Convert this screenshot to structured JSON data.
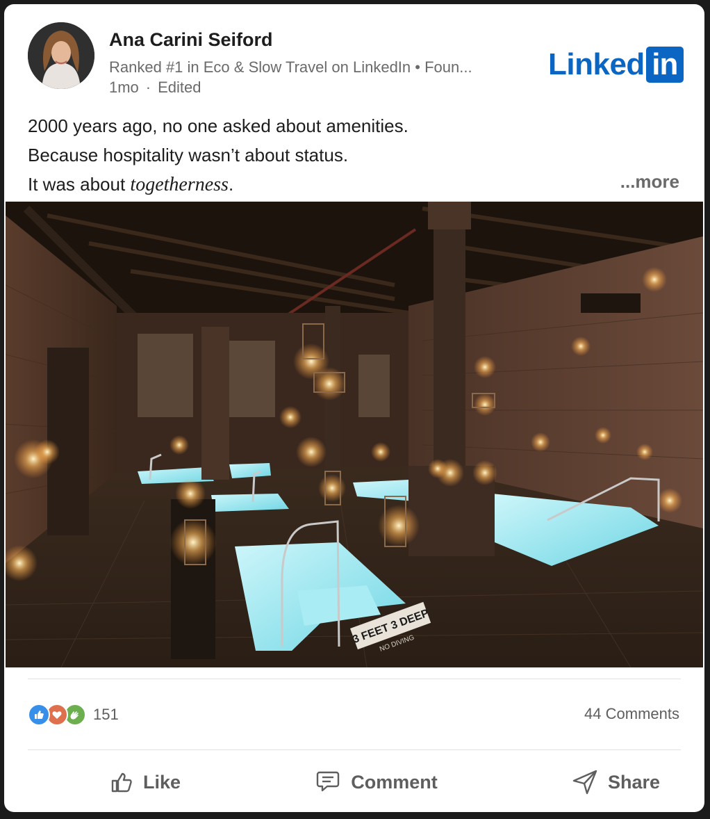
{
  "post": {
    "author": {
      "name": "Ana Carini Seiford",
      "headline": "Ranked #1 in Eco & Slow Travel on LinkedIn • Foun...",
      "time": "1mo",
      "separator": "·",
      "edited": "Edited"
    },
    "brand": {
      "word": "Linked",
      "box": "in"
    },
    "text": {
      "line1": "2000 years ago, no one asked about amenities.",
      "line2": "Because hospitality wasn’t about status.",
      "line3_prefix": "It was about ",
      "line3_italic": "togetherness",
      "line3_suffix": ".",
      "more": "...more"
    },
    "image": {
      "sign_text": "3 FEET 3 DEEP",
      "sign_sub": "NO DIVING"
    },
    "social": {
      "reactions": [
        "like-reaction-icon",
        "love-reaction-icon",
        "celebrate-reaction-icon"
      ],
      "reaction_count": "151",
      "comments": "44 Comments"
    },
    "actions": {
      "like": "Like",
      "comment": "Comment",
      "share": "Share"
    },
    "colors": {
      "brand_blue": "#0a66c2",
      "pool": "#7fe3ee",
      "text_muted": "#6a6a6a"
    }
  }
}
